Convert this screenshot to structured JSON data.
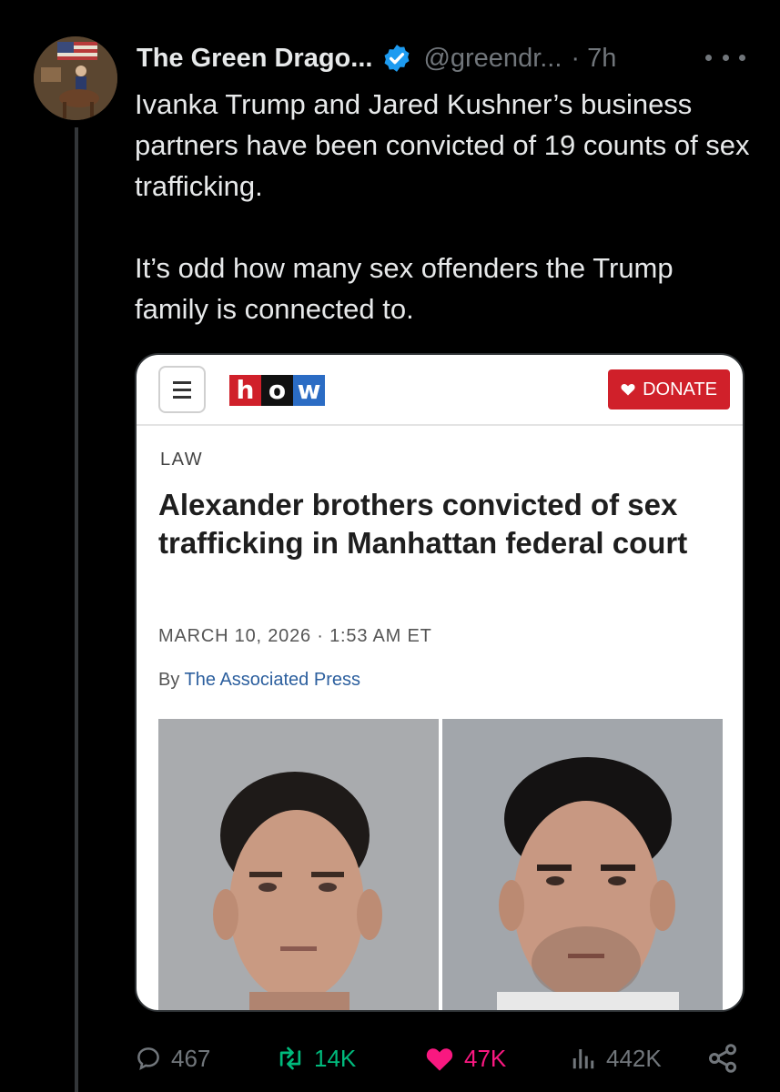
{
  "tweet": {
    "author_name": "The Green Drago...",
    "handle": "@greendr...",
    "time": "· 7h",
    "text_paragraphs": [
      "Ivanka Trump and Jared Kushner’s business partners have been convicted of 19 counts of sex trafficking.",
      "It’s odd how many sex offenders the Trump family is connected to."
    ]
  },
  "card": {
    "logo_letters": [
      "h",
      "o",
      "w"
    ],
    "donate_label": "DONATE",
    "section": "LAW",
    "headline": "Alexander brothers convicted of sex trafficking in Manhattan federal court",
    "dateline": "MARCH 10, 2026 · 1:53 AM ET",
    "byline_prefix": "By",
    "byline_author": "The Associated Press"
  },
  "actions": {
    "reply_count": "467",
    "retweet_count": "14K",
    "like_count": "47K",
    "views_count": "442K"
  },
  "colors": {
    "background": "#000000",
    "text": "#e7e9ea",
    "muted": "#71767b",
    "verified": "#1d9bf0",
    "retweet": "#00ba7c",
    "like": "#f91880",
    "donate": "#d0202a"
  },
  "icons": [
    "verified-badge-icon",
    "more-icon",
    "menu-icon",
    "heart-icon",
    "reply-icon",
    "retweet-icon",
    "like-icon",
    "views-icon",
    "share-icon"
  ]
}
